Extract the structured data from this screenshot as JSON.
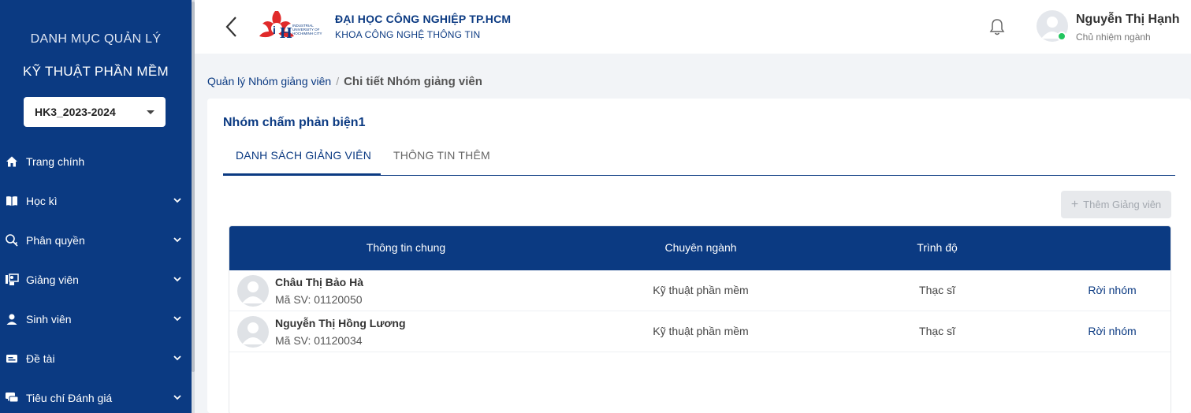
{
  "sidebar": {
    "title1": "DANH MỤC QUẢN LÝ",
    "title2": "KỸ THUẬT PHẦN MỀM",
    "semester": "HK3_2023-2024",
    "items": [
      {
        "label": "Trang chính"
      },
      {
        "label": "Học kì"
      },
      {
        "label": "Phân quyền"
      },
      {
        "label": "Giảng viên"
      },
      {
        "label": "Sinh viên"
      },
      {
        "label": "Đề tài"
      },
      {
        "label": "Tiêu chí Đánh giá"
      }
    ]
  },
  "header": {
    "university": "ĐẠI HỌC CÔNG NGHIỆP TP.HCM",
    "faculty": "KHOA CÔNG NGHỆ THÔNG TIN",
    "user_name": "Nguyễn Thị Hạnh",
    "user_role": "Chủ nhiệm ngành"
  },
  "breadcrumb": {
    "parent": "Quản lý Nhóm giảng viên",
    "separator": "/",
    "current": "Chi tiết Nhóm giảng viên"
  },
  "card": {
    "title": "Nhóm chấm phản biện1",
    "tabs": [
      {
        "label": "DANH SÁCH GIẢNG VIÊN"
      },
      {
        "label": "THÔNG TIN THÊM"
      }
    ],
    "add_button": "Thêm Giảng viên"
  },
  "table": {
    "headers": [
      "Thông tin chung",
      "Chuyên ngành",
      "Trình độ"
    ],
    "rows": [
      {
        "name": "Châu Thị Bảo Hà",
        "code": "Mã SV: 01120050",
        "major": "Kỹ thuật phần mềm",
        "degree": "Thạc sĩ",
        "action": "Rời nhóm"
      },
      {
        "name": "Nguyễn Thị Hồng Lương",
        "code": "Mã SV: 01120034",
        "major": "Kỹ thuật phần mềm",
        "degree": "Thạc sĩ",
        "action": "Rời nhóm"
      }
    ]
  },
  "colors": {
    "primary": "#0b3a82",
    "online": "#22c55e",
    "logo_red": "#e02a2a"
  }
}
